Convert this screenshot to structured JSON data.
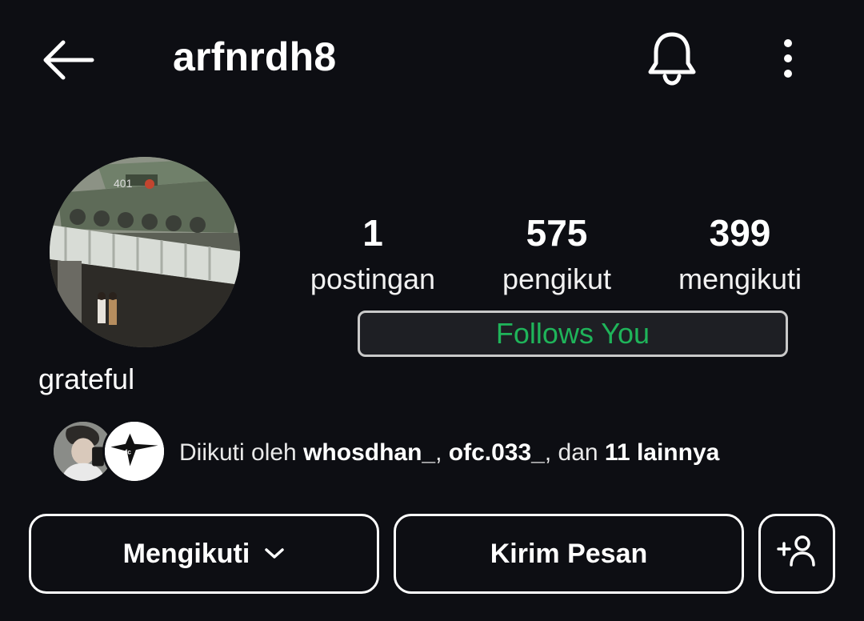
{
  "header": {
    "username": "arfnrdh8",
    "back_icon": "arrow-left-icon",
    "bell_icon": "bell-icon",
    "more_icon": "more-vertical-icon"
  },
  "profile": {
    "stats": [
      {
        "value": "1",
        "label": "postingan"
      },
      {
        "value": "575",
        "label": "pengikut"
      },
      {
        "value": "399",
        "label": "mengikuti"
      }
    ],
    "follows_you": "Follows You",
    "bio": "grateful"
  },
  "followed_by": {
    "prefix": "Diikuti oleh ",
    "user1": "whosdhan_",
    "sep1": ", ",
    "user2": "ofc.033_",
    "sep2": ", dan ",
    "others": "11 lainnya"
  },
  "actions": {
    "following_label": "Mengikuti",
    "message_label": "Kirim Pesan",
    "add_user_icon": "add-person-icon"
  },
  "colors": {
    "background": "#0d0e13",
    "accent_green": "#1fb45a"
  }
}
